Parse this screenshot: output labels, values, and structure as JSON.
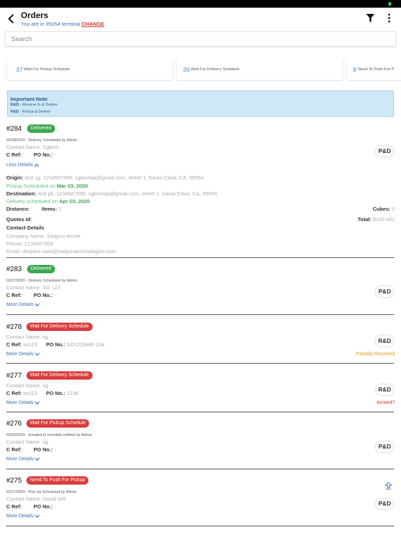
{
  "header": {
    "title": "Orders",
    "subtitle_prefix": "You are in",
    "terminal_id": "95054",
    "subtitle_mid": "terminal",
    "change_label": "CHANGE"
  },
  "search": {
    "placeholder": "Search"
  },
  "cards": [
    {
      "count": "37",
      "label": "Wait For Pickup Schedule"
    },
    {
      "count": "26",
      "label": "Wait For Delivery Schedule"
    },
    {
      "count": "8",
      "label": "Need To Push For P"
    }
  ],
  "note": {
    "title": "Important Note",
    "line1_key": "R&D",
    "line1_text": " - Receive In & Deliver",
    "line2_key": "P&D",
    "line2_text": " - Pickup & Deliver"
  },
  "labels": {
    "cref": "C Ref:",
    "pono": "PO No.:",
    "more_details": "More Details",
    "less_details": "Less Details",
    "origin": "Origin:",
    "destination": "Destination:",
    "distance": "Distance:",
    "items": "Items:",
    "cubes": "Cubes:",
    "quotes": "Quotes Id:",
    "total": "Total:",
    "contact_details": "Contact Details"
  },
  "orders": [
    {
      "number": "#284",
      "status": "Delivered",
      "schedule": "02/28/2020 - Delivery Scheduled by Admin",
      "contact": "Contact Name: Sgtech",
      "cref": "-",
      "pono": "-",
      "type": "P&D",
      "details": {
        "origin": "test sg, 1234567890, sgtechqa@gmail.com, street 1, Santa Clara, CA, 95054",
        "pickup_prefix": "Pickup Scheduled on",
        "pickup_date": "Mar 03, 2020",
        "destination": "test pb, 1234567890, sgtechqa@gmail.com, street 1, Santa Clara, CA, 95054",
        "delivery_prefix": "Delivery scheduled on",
        "delivery_date": "Apr 03, 2020",
        "distance": "-",
        "items": "1",
        "cubes": "0",
        "quotes": "-",
        "total": "$100.001",
        "company": "Company Name: Satguru techie",
        "phone": "Phone: 2134567808",
        "email": "Email: deepika.saini@satgurutechnologies.com"
      }
    },
    {
      "number": "#283",
      "status": "Delivered",
      "schedule": "02/27/2020 - Delivery Scheduled by Admin",
      "contact": "Contact Name: SG 123",
      "cref": "-",
      "pono": "-",
      "type": "P&D"
    },
    {
      "number": "#278",
      "status": "Wait For Delivery Schedule",
      "contact": "Contact Name: sg",
      "cref": "so123",
      "pono": "SO1229s80 13a",
      "type": "R&D",
      "state": "Partially Received"
    },
    {
      "number": "#277",
      "status": "Wait For Delivery Schedule",
      "contact": "Contact Name: sg",
      "cref": "so123",
      "pono": "1238",
      "type": "R&D",
      "state": "Arrived?"
    },
    {
      "number": "#276",
      "status": "Wait For Pickup Schedule",
      "schedule": "03/20/2020 - Emailed to schedule notified by Admin",
      "contact": "Contact Name: sg",
      "cref": "-",
      "pono": "-",
      "type": "P&D"
    },
    {
      "number": "#275",
      "status": "Need To Push For Pickup",
      "schedule": "02/27/2020 - Pick Up Scheduled by Admin",
      "contact": "Contact Name: David Will",
      "cref": "-",
      "pono": "-",
      "type": "P&D"
    }
  ],
  "colors": {
    "delivered": "#3aa74f",
    "waiting": "#d93d3d",
    "link": "#3a6fb6",
    "note_bg": "#cfe8f7"
  },
  "icons": {
    "back": "chevron-left-icon",
    "filter": "filter-icon",
    "more": "more-vertical-icon",
    "push": "upload-arrow-icon"
  }
}
